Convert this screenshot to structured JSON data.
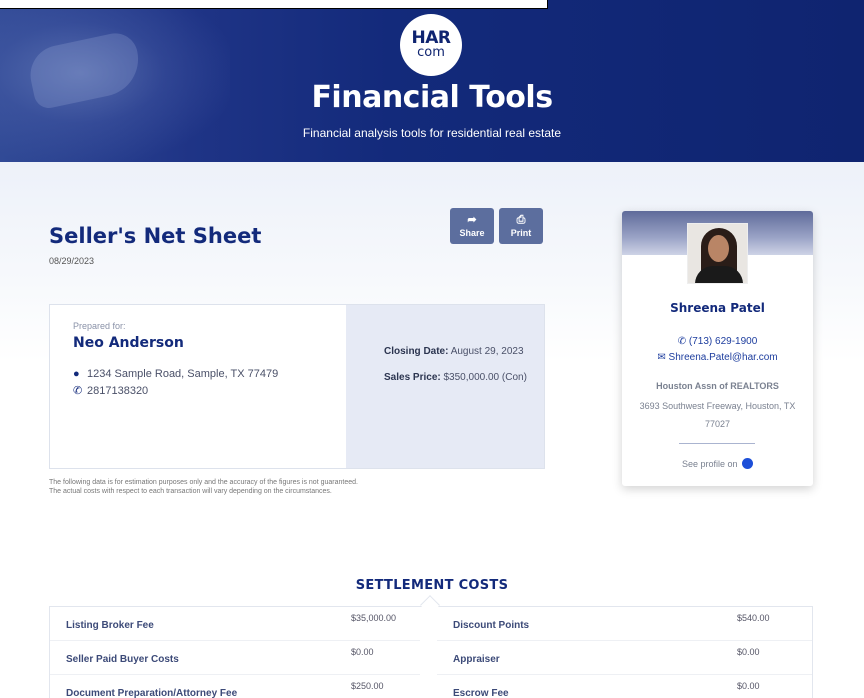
{
  "header": {
    "logo_line1": "HAR",
    "logo_line2": "com",
    "title": "Financial Tools",
    "subtitle": "Financial analysis tools for residential real estate"
  },
  "page": {
    "title": "Seller's Net Sheet",
    "date": "08/29/2023"
  },
  "actions": {
    "share_label": "Share",
    "print_label": "Print"
  },
  "prepared": {
    "label": "Prepared for:",
    "name": "Neo Anderson",
    "address": "1234 Sample Road, Sample, TX 77479",
    "phone": "2817138320",
    "closing_date_label": "Closing Date:",
    "closing_date": "August 29, 2023",
    "sales_price_label": "Sales Price:",
    "sales_price": "$350,000.00 (Con)"
  },
  "disclaimer": {
    "line1": "The following data is for estimation purposes only and the accuracy of the figures is not guaranteed.",
    "line2": "The actual costs with respect to each transaction will vary depending on the circumstances."
  },
  "agent": {
    "name": "Shreena Patel",
    "phone": "(713) 629-1900",
    "email": "Shreena.Patel@har.com",
    "org": "Houston Assn of REALTORS",
    "address": "3693 Southwest Freeway, Houston, TX 77027",
    "profile_link": "See profile on"
  },
  "settlement": {
    "title": "SETTLEMENT COSTS",
    "left": [
      {
        "label": "Listing Broker Fee",
        "value": "$35,000.00"
      },
      {
        "label": "Seller Paid Buyer Costs",
        "value": "$0.00"
      },
      {
        "label": "Document Preparation/Attorney Fee",
        "value": "$250.00"
      }
    ],
    "right": [
      {
        "label": "Discount Points",
        "value": "$540.00"
      },
      {
        "label": "Appraiser",
        "value": "$0.00"
      },
      {
        "label": "Escrow Fee",
        "value": "$0.00"
      }
    ]
  },
  "colors": {
    "brand_navy": "#132a7b",
    "button_gray_blue": "#5c6e9e",
    "link_blue": "#1d3d9e"
  }
}
